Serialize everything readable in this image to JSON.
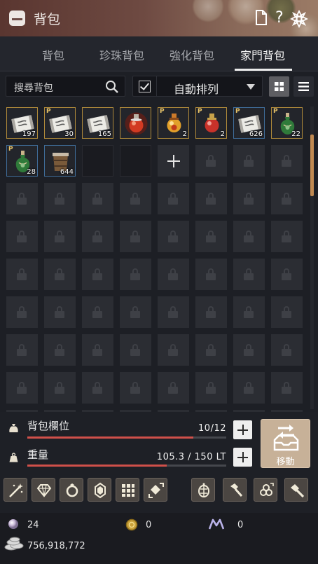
{
  "window": {
    "title": "背包"
  },
  "titlebar_buttons": [
    "document-icon",
    "help-icon",
    "settings-flower-icon"
  ],
  "titlebar_help": "?",
  "tabs": [
    {
      "label": "背包",
      "active": false
    },
    {
      "label": "珍珠背包",
      "active": false
    },
    {
      "label": "強化背包",
      "active": false
    },
    {
      "label": "家門背包",
      "active": true
    }
  ],
  "search": {
    "placeholder": "搜尋背包"
  },
  "sort": {
    "label": "自動排列",
    "checked": true
  },
  "view_modes": {
    "selected": "grid"
  },
  "items": [
    {
      "name": "scroll-item",
      "qty": "197",
      "p": false,
      "border": "gold",
      "art": "scroll"
    },
    {
      "name": "scroll-item",
      "qty": "30",
      "p": true,
      "border": "gold",
      "art": "scroll"
    },
    {
      "name": "scroll-item",
      "qty": "165",
      "p": false,
      "border": "gold",
      "art": "scroll"
    },
    {
      "name": "red-elixir-item",
      "qty": "",
      "p": false,
      "border": "gold",
      "art": "redflask"
    },
    {
      "name": "gold-elixir-item",
      "qty": "2",
      "p": true,
      "border": "gold",
      "art": "goldflask"
    },
    {
      "name": "red-elixir-item",
      "qty": "2",
      "p": true,
      "border": "gold",
      "art": "redflask2"
    },
    {
      "name": "scroll-item",
      "qty": "626",
      "p": true,
      "border": "blue",
      "art": "scroll"
    },
    {
      "name": "green-elixir-item",
      "qty": "22",
      "p": true,
      "border": "gold",
      "art": "greenflask"
    },
    {
      "name": "green-elixir-item",
      "qty": "28",
      "p": true,
      "border": "blue",
      "art": "greenflask"
    },
    {
      "name": "barrel-item",
      "qty": "644",
      "p": false,
      "border": "blue",
      "art": "barrel"
    }
  ],
  "grid": {
    "empty_slots": 2,
    "add_slot": 1,
    "locked_slots": 59
  },
  "capacity": {
    "label": "背包欄位",
    "value": "10/12",
    "fraction": 0.8333
  },
  "weight": {
    "label": "重量",
    "value": "105.3 / 150 LT",
    "fraction": 0.702
  },
  "move_button": {
    "label": "移動"
  },
  "tools": [
    "magic-wand-icon",
    "gem-icon",
    "ring-icon",
    "crystal-icon",
    "grid-icon",
    "puzzle-icon",
    "lantern-icon",
    "hammer-icon",
    "triskelion-icon",
    "anvil-hammer-icon"
  ],
  "currency": {
    "pearl": "24",
    "coin": "0",
    "mileage": "0",
    "silver": "756,918,772"
  },
  "colors": {
    "accent_bar": "#d0504a",
    "gold_border": "#b08a3a",
    "blue_border": "#3f6c98",
    "title_bar": "#6e4a42"
  }
}
